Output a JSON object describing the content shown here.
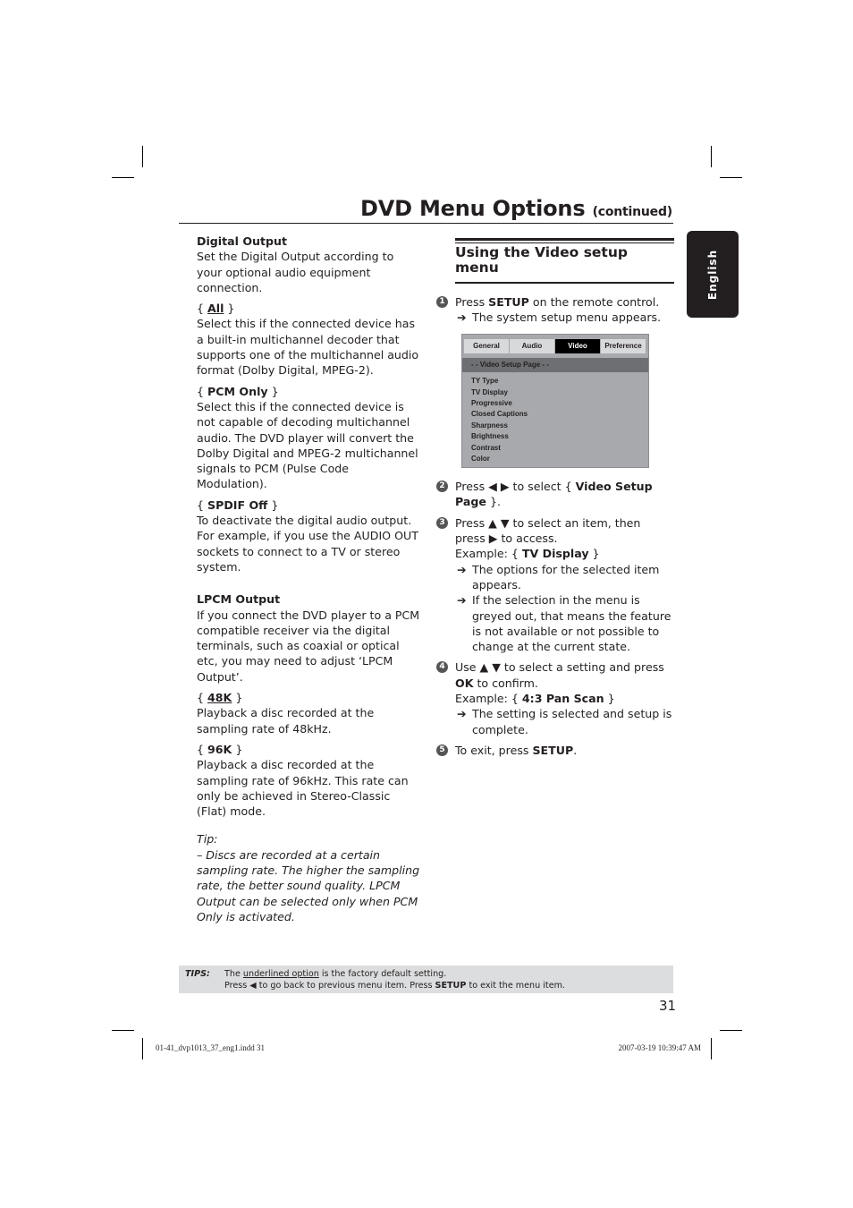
{
  "header": {
    "title": "DVD Menu Options",
    "title_suffix": "(continued)",
    "language_tab": "English"
  },
  "left_column": {
    "digital_output": {
      "heading": "Digital Output",
      "intro": "Set the Digital Output according to your optional audio equipment connection.",
      "options": [
        {
          "label": "All",
          "default": true,
          "description": "Select this if the connected device has a built-in multichannel decoder that supports one of the multichannel audio format (Dolby Digital, MPEG-2)."
        },
        {
          "label": "PCM Only",
          "default": false,
          "description": "Select this if the connected device is not capable of decoding multichannel audio. The DVD player will convert the Dolby Digital and MPEG-2 multichannel signals to PCM (Pulse Code Modulation)."
        },
        {
          "label": "SPDIF Off",
          "default": false,
          "description": "To deactivate the digital audio output. For example, if you use the AUDIO OUT sockets to connect to a TV or stereo system."
        }
      ]
    },
    "lpcm_output": {
      "heading": "LPCM Output",
      "intro": "If you connect the DVD player to a PCM compatible receiver via the digital terminals, such as coaxial or optical etc, you may need to adjust ‘LPCM Output’.",
      "options": [
        {
          "label": "48K",
          "default": true,
          "description": "Playback a disc recorded at the sampling rate of 48kHz."
        },
        {
          "label": "96K",
          "default": false,
          "description": "Playback a disc recorded at the sampling rate of 96kHz. This rate can only be achieved in Stereo-Classic (Flat) mode."
        }
      ]
    },
    "tip": {
      "label": "Tip:",
      "text": "– Discs are recorded at a certain sampling rate. The higher the sampling rate, the better sound quality. LPCM Output can be selected only when PCM Only is activated."
    }
  },
  "right_column": {
    "section_heading": "Using the Video setup menu",
    "steps": [
      {
        "num": "1",
        "pre": "Press ",
        "bold": "SETUP",
        "post": " on the remote control.",
        "results": [
          "The system setup menu appears."
        ]
      },
      {
        "num": "2",
        "pre": "Press ◀ ▶ to select { ",
        "bold": "Video Setup Page",
        "post": " }.",
        "results": []
      },
      {
        "num": "3",
        "pre": "Press ▲ ▼ to select an item, then press ▶ to access.",
        "example_pre": "Example: { ",
        "example_bold": "TV Display",
        "example_post": " }",
        "results": [
          "The options for the selected item appears.",
          "If the selection in the menu is greyed out, that means the feature is not available or not possible to change at the current state."
        ]
      },
      {
        "num": "4",
        "pre": "Use ▲ ▼ to select a setting and press ",
        "bold": "OK",
        "post": " to confirm.",
        "example_pre": "Example: { ",
        "example_bold": "4:3 Pan Scan",
        "example_post": " }",
        "results": [
          "The setting is selected and setup is complete."
        ]
      },
      {
        "num": "5",
        "pre": "To exit, press ",
        "bold": "SETUP",
        "post": ".",
        "results": []
      }
    ],
    "arrow_glyph": "➔",
    "osd": {
      "tabs": [
        {
          "label": "General",
          "active": false
        },
        {
          "label": "Audio",
          "active": false
        },
        {
          "label": "Video",
          "active": true
        },
        {
          "label": "Preference",
          "active": false
        }
      ],
      "page_title": "- -   Video Setup Page   - -",
      "items": [
        "TY Type",
        "TV Display",
        "Progressive",
        "Closed Captions",
        "Sharpness",
        "Brightness",
        "Contrast",
        "Color"
      ]
    }
  },
  "tips_bar": {
    "label": "TIPS:",
    "line1_pre": "The ",
    "line1_underlined": "underlined option",
    "line1_post": " is the factory default setting.",
    "line2_pre": "Press ◀ to go back to previous menu item. Press ",
    "line2_bold": "SETUP",
    "line2_post": " to exit the menu item."
  },
  "footer": {
    "page_number": "31",
    "slug_left": "01-41_dvp1013_37_eng1.indd   31",
    "slug_right": "2007-03-19   10:39:47 AM"
  },
  "colors": {
    "text": "#231f20",
    "tips_background": "#dcddde",
    "osd_background": "#a7a9ac",
    "osd_page_bar": "#6d6f72",
    "osd_active_tab": "#000000"
  }
}
